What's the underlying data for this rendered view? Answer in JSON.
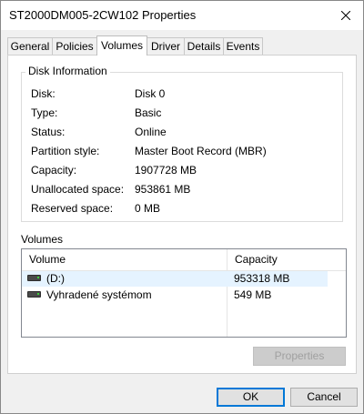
{
  "window": {
    "title": "ST2000DM005-2CW102 Properties"
  },
  "tabs": [
    {
      "label": "General"
    },
    {
      "label": "Policies"
    },
    {
      "label": "Volumes"
    },
    {
      "label": "Driver"
    },
    {
      "label": "Details"
    },
    {
      "label": "Events"
    }
  ],
  "active_tab": "Volumes",
  "disk_info": {
    "title": "Disk Information",
    "rows": [
      {
        "label": "Disk:",
        "value": "Disk 0"
      },
      {
        "label": "Type:",
        "value": "Basic"
      },
      {
        "label": "Status:",
        "value": "Online"
      },
      {
        "label": "Partition style:",
        "value": "Master Boot Record (MBR)"
      },
      {
        "label": "Capacity:",
        "value": "1907728 MB"
      },
      {
        "label": "Unallocated space:",
        "value": "953861 MB"
      },
      {
        "label": "Reserved space:",
        "value": "0 MB"
      }
    ]
  },
  "volumes": {
    "title": "Volumes",
    "columns": {
      "volume": "Volume",
      "capacity": "Capacity"
    },
    "rows": [
      {
        "name": "(D:)",
        "capacity": "953318 MB",
        "selected": true
      },
      {
        "name": "Vyhradené systémom",
        "capacity": "549 MB",
        "selected": false
      }
    ],
    "properties_label": "Properties"
  },
  "buttons": {
    "ok": "OK",
    "cancel": "Cancel"
  },
  "icons": {
    "close": "close-icon",
    "drive": "drive-icon"
  },
  "colors": {
    "accent": "#0078d7",
    "selection": "#e5f3ff"
  }
}
